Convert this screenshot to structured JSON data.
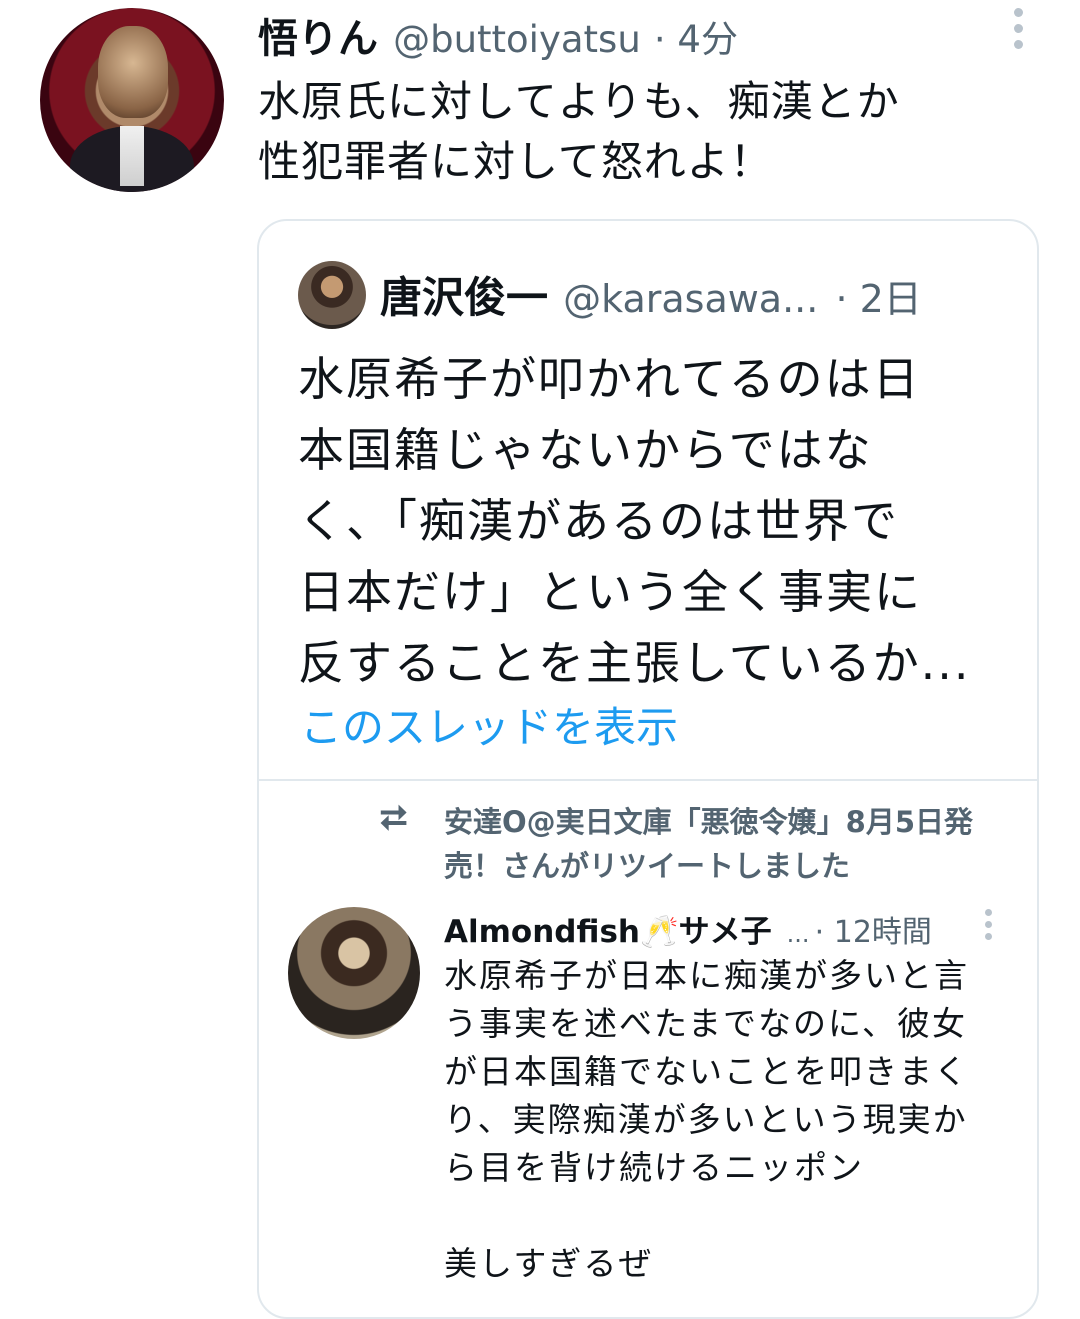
{
  "tweet": {
    "author_name": "悟りん",
    "handle": "@buttoiyatsu",
    "time": "· 4分",
    "text_line1": "水原氏に対してよりも、痴漢とか",
    "text_line2": "性犯罪者に対して怒れよ！"
  },
  "quoted": {
    "author_name": "唐沢俊一",
    "handle": "@karasawa...",
    "time": "· 2日",
    "lines": [
      "水原希子が叩かれてるのは日",
      "本国籍じゃないからではな",
      "く、「痴漢があるのは世界で",
      "日本だけ」という全く事実に",
      "反することを主張しているか..."
    ],
    "show_thread": "このスレッドを表示"
  },
  "retweet": {
    "line1": "安達O@実日文庫「悪徳令嬢」8月5日発",
    "line2": "売！さんがリツイートしました"
  },
  "inner": {
    "author_name": "Almondfish🥂サメ子",
    "ellipsis": "...",
    "time": "· 12時間",
    "lines": [
      "水原希子が日本に痴漢が多いと言",
      "う事実を述べたまでなのに、彼女",
      "が日本国籍でないことを叩きまく",
      "り、実際痴漢が多いという現実か",
      "ら目を背け続けるニッポン"
    ],
    "last_line": "美しすぎるぜ"
  }
}
